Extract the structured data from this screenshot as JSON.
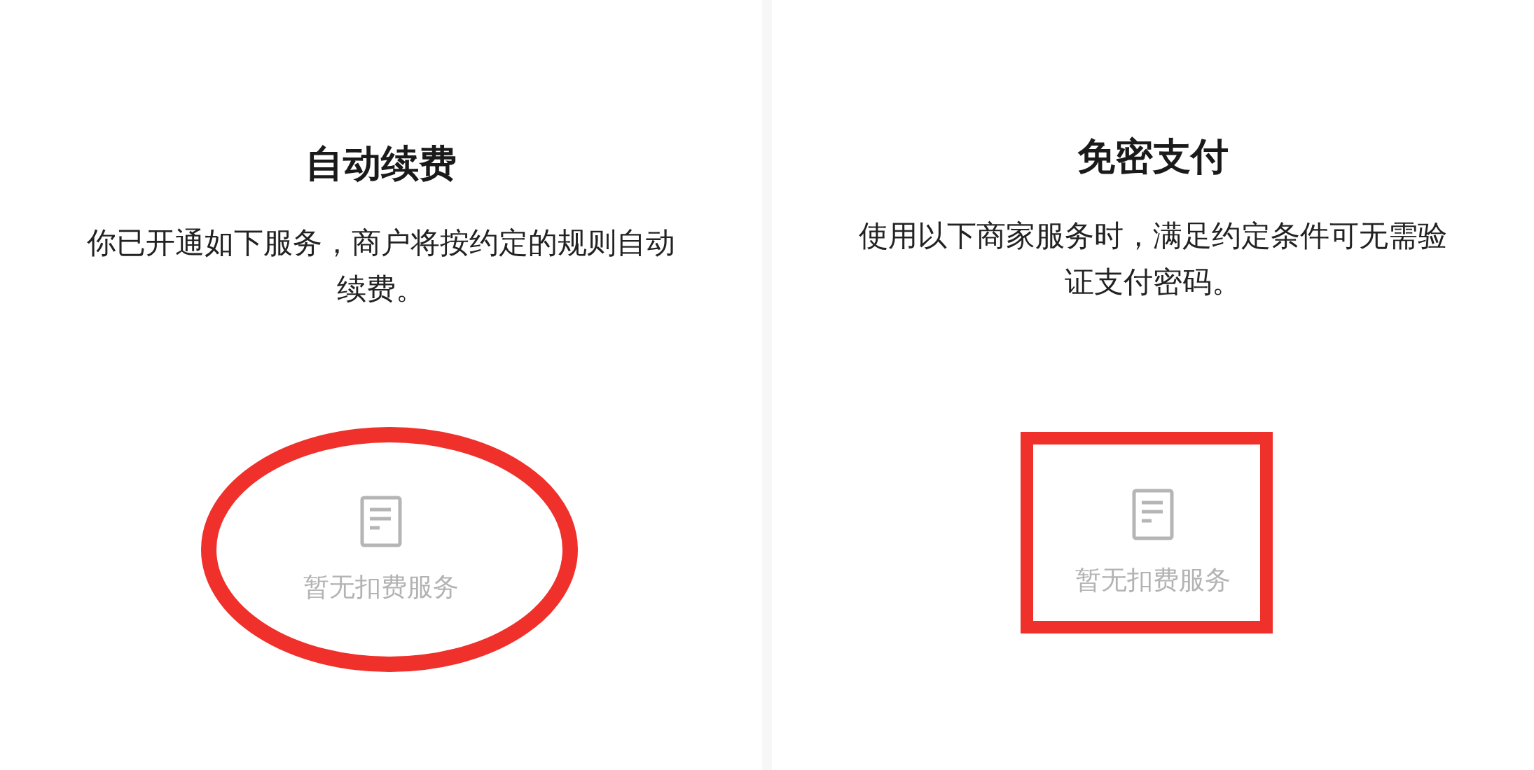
{
  "panels": [
    {
      "title": "自动续费",
      "description": "你已开通如下服务，商户将按约定的规则自动续费。",
      "empty_state": "暂无扣费服务",
      "annotation": {
        "kind": "ellipse",
        "color": "#f0302a"
      }
    },
    {
      "title": "免密支付",
      "description": "使用以下商家服务时，满足约定条件可无需验证支付密码。",
      "empty_state": "暂无扣费服务",
      "annotation": {
        "kind": "rectangle",
        "color": "#f0302a"
      }
    }
  ]
}
